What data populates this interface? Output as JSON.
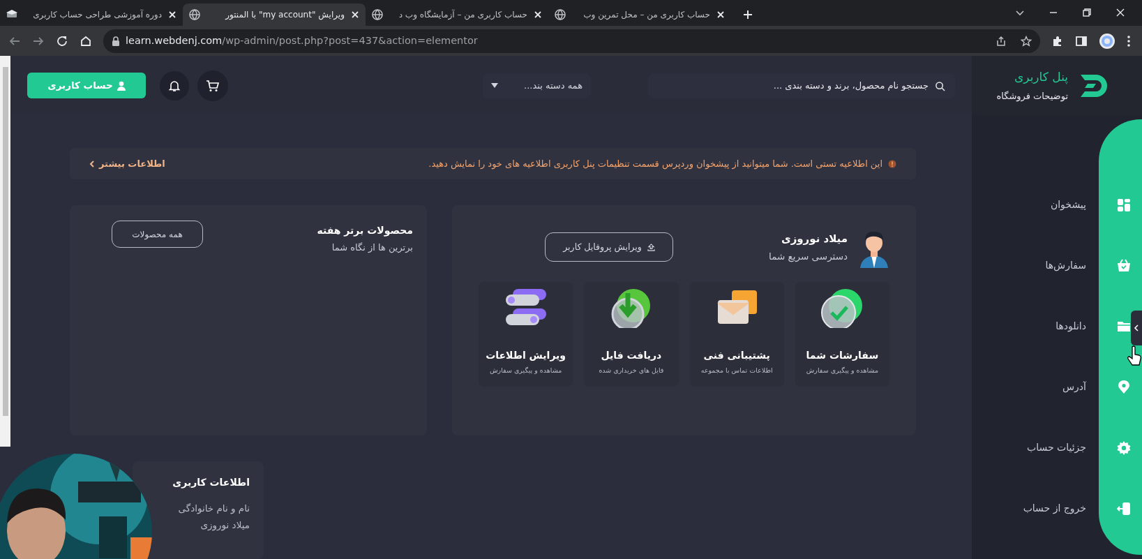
{
  "browser": {
    "tabs": [
      {
        "title": "حساب کاربری من – محل تمرین وب",
        "kind": "globe",
        "selected": false
      },
      {
        "title": "حساب کاربری من – آزمایشگاه وب د",
        "kind": "globe",
        "selected": false
      },
      {
        "title": "ویرایش \"my account\" با المنتور",
        "kind": "globe",
        "selected": true
      },
      {
        "title": "دوره آموزشی طراحی حساب کاربری",
        "kind": "cap",
        "selected": false
      }
    ],
    "address_bar": {
      "host": "learn.webdenj.com",
      "path": "/wp-admin/post.php?post=437&action=elementor"
    }
  },
  "header": {
    "logo_title": "پنل کاربری",
    "logo_subtitle": "توضیحات فروشگاه",
    "search_placeholder": "جستجو نام محصول، برند و دسته بندی ...",
    "category_select": "همه دسته بند...",
    "account_button": "حساب کاربری"
  },
  "sidebar": {
    "items": [
      {
        "label": "پیشخوان",
        "kind": "dashboard"
      },
      {
        "label": "سفارش‌ها",
        "kind": "basket"
      },
      {
        "label": "دانلودها",
        "kind": "folder"
      },
      {
        "label": "آدرس",
        "kind": "pin"
      },
      {
        "label": "جزئیات حساب",
        "kind": "gear"
      },
      {
        "label": "خروج از حساب",
        "kind": "logout"
      }
    ]
  },
  "notice": {
    "text": "این اطلاعیه تستی است. شما میتوانید از پیشخوان وردپرس قسمت تنظیمات پنل کاربری اطلاعیه های خود را نمایش دهید.",
    "link": "اطلاعات بیشتر"
  },
  "top_products": {
    "title": "محصولات برتر هفته",
    "subtitle": "برترین ها از نگاه شما",
    "button": "همه محصولات"
  },
  "profile": {
    "name": "میلاد نوروزی",
    "subtitle": "دسترسی سریع شما",
    "edit_button": "ویرایش پروفایل کاربر",
    "shortcuts": [
      {
        "title": "سفارشات شما",
        "subtitle": "مشاهده و پیگیری سفارش",
        "kind": "check"
      },
      {
        "title": "پشتیبانی فنی",
        "subtitle": "اطلاعات تماس با مجموعه",
        "kind": "mail"
      },
      {
        "title": "دریافت فایل",
        "subtitle": "فایل های خریداری شده",
        "kind": "download"
      },
      {
        "title": "ویرایش اطلاعات",
        "subtitle": "مشاهده و پیگیری سفارش",
        "kind": "toggles"
      }
    ]
  },
  "user_info": {
    "title": "اطلاعات کاربری",
    "fields": [
      {
        "label": "نام و نام خانوادگی",
        "value": "میلاد نوروزی"
      }
    ]
  }
}
